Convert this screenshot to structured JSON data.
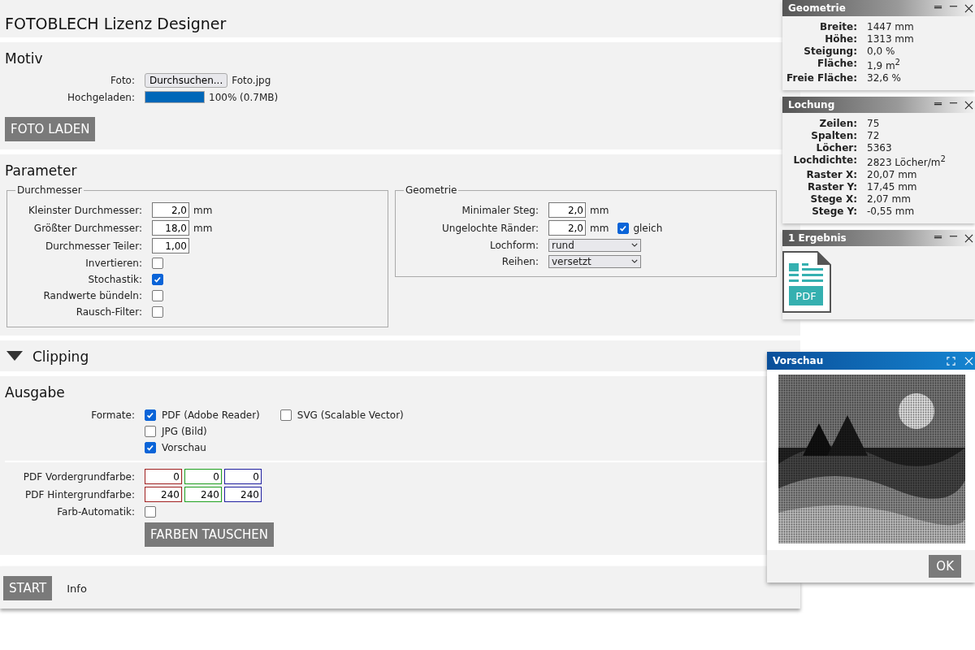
{
  "title": "FOTOBLECH Lizenz Designer",
  "motiv": {
    "heading": "Motiv",
    "foto_label": "Foto:",
    "browse_button": "Durchsuchen...",
    "filename": "Foto.jpg",
    "uploaded_label": "Hochgeladen:",
    "upload": {
      "level": 1,
      "reading": "100% (0.7MB)"
    },
    "load_button": "FOTO LADEN"
  },
  "parameter": {
    "heading": "Parameter",
    "groups": [
      {
        "legend": "Durchmesser",
        "rows": [
          {
            "kind": "number",
            "label": "Kleinster Durchmesser:",
            "value": "2,0",
            "unit": "mm"
          },
          {
            "kind": "number",
            "label": "Größter Durchmesser:",
            "value": "18,0",
            "unit": "mm"
          },
          {
            "kind": "number",
            "label": "Durchmesser Teiler:",
            "value": "1,00"
          },
          {
            "kind": "checkbox",
            "label": "Invertieren:",
            "checked": false
          },
          {
            "kind": "checkbox",
            "label": "Stochastik:",
            "checked": true
          },
          {
            "kind": "checkbox",
            "label": "Randwerte bündeln:",
            "checked": false
          },
          {
            "kind": "checkbox",
            "label": "Rausch-Filter:",
            "checked": false
          }
        ]
      },
      {
        "legend": "Geometrie",
        "rows": [
          {
            "kind": "number",
            "label": "Minimaler Steg:",
            "value": "2,0",
            "unit": "mm"
          },
          {
            "kind": "number",
            "label": "Ungelochte Ränder:",
            "value": "2,0",
            "unit": "mm",
            "extra": {
              "label": "gleich",
              "checked": true
            }
          },
          {
            "kind": "select",
            "label": "Lochform:",
            "value": "rund"
          },
          {
            "kind": "select",
            "label": "Reihen:",
            "value": "versetzt"
          }
        ]
      }
    ]
  },
  "clipping": {
    "heading": "Clipping"
  },
  "ausgabe": {
    "heading": "Ausgabe",
    "formats_label": "Formate:",
    "formats": [
      {
        "label": "PDF (Adobe Reader)",
        "checked": true
      },
      {
        "label": "JPG (Bild)",
        "checked": false
      },
      {
        "label": "Vorschau",
        "checked": true
      },
      {
        "label": "SVG (Scalable Vector)",
        "checked": false
      }
    ],
    "color_rows": [
      {
        "label": "PDF Vordergrundfarbe:",
        "fields": [
          {
            "value": "0",
            "color": "#a02020"
          },
          {
            "value": "0",
            "color": "#20a020"
          },
          {
            "value": "0",
            "color": "#2020a0"
          }
        ]
      },
      {
        "label": "PDF Hintergrundfarbe:",
        "fields": [
          {
            "value": "240",
            "color": "#a02020"
          },
          {
            "value": "240",
            "color": "#20a020"
          },
          {
            "value": "240",
            "color": "#2020a0"
          }
        ]
      }
    ],
    "auto_label": "Farb-Automatik:",
    "auto_checked": false,
    "swap_button": "FARBEN TAUSCHEN"
  },
  "footer": {
    "start_button": "START",
    "info_link": "Info"
  },
  "panels": [
    {
      "title": "Geometrie",
      "rows": [
        {
          "label": "Breite:",
          "value": "1447 mm"
        },
        {
          "label": "Höhe:",
          "value": "1313 mm"
        },
        {
          "label": "Steigung:",
          "value": "0,0 %"
        },
        {
          "label": "Fläche:",
          "value": "1,9 m$^{2}$"
        },
        {
          "label": "Freie Fläche:",
          "value": "32,6 %"
        }
      ]
    },
    {
      "title": "Lochung",
      "rows": [
        {
          "label": "Zeilen:",
          "value": "75"
        },
        {
          "label": "Spalten:",
          "value": "72"
        },
        {
          "label": "Löcher:",
          "value": "5363"
        },
        {
          "label": "Lochdichte:",
          "value": "2823 Löcher/m$^{2}$"
        },
        {
          "label": "Raster X:",
          "value": "20,07 mm"
        },
        {
          "label": "Raster Y:",
          "value": "17,45 mm"
        },
        {
          "label": "Stege X:",
          "value": "2,07 mm"
        },
        {
          "label": "Stege Y:",
          "value": "-0,55 mm"
        }
      ]
    }
  ],
  "results": {
    "title": "1 Ergebnis",
    "files": [
      {
        "label": "PDF"
      }
    ]
  },
  "preview": {
    "title": "Vorschau",
    "ok_button": "OK"
  }
}
